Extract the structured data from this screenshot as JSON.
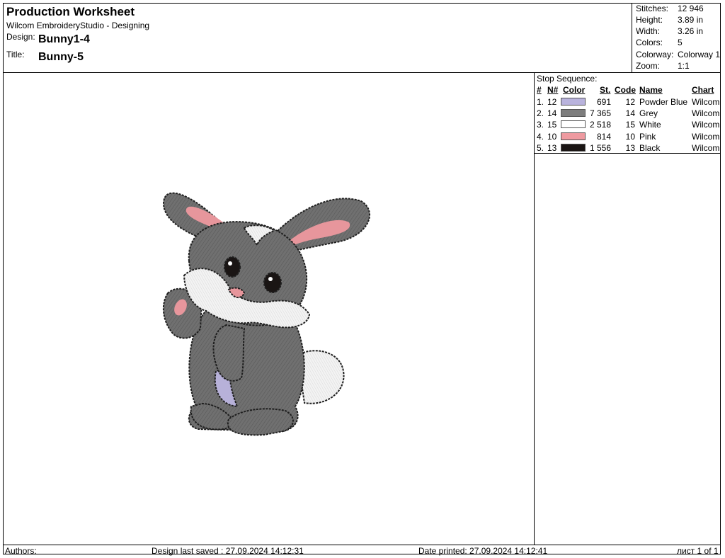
{
  "header": {
    "title": "Production Worksheet",
    "subtitle": "Wilcom EmbroideryStudio - Designing",
    "design_label": "Design:",
    "design_value": "Bunny1-4",
    "title_label": "Title:",
    "title_value": "Bunny-5"
  },
  "stats": [
    {
      "label": "Stitches:",
      "value": "12 946"
    },
    {
      "label": "Height:",
      "value": "3.89 in"
    },
    {
      "label": "Width:",
      "value": "3.26 in"
    },
    {
      "label": "Colors:",
      "value": "5"
    },
    {
      "label": "Colorway:",
      "value": "Colorway 1"
    },
    {
      "label": "Zoom:",
      "value": "1:1"
    }
  ],
  "stop_sequence": {
    "caption": "Stop Sequence:",
    "columns": {
      "idx": "#",
      "n": "N#",
      "color": "Color",
      "st": "St.",
      "code": "Code",
      "name": "Name",
      "chart": "Chart"
    },
    "rows": [
      {
        "idx": "1.",
        "n": "12",
        "swatch": "#b9b3dd",
        "st": "691",
        "code": "12",
        "name": "Powder Blue",
        "chart": "Wilcom"
      },
      {
        "idx": "2.",
        "n": "14",
        "swatch": "#7d7d7d",
        "st": "7 365",
        "code": "14",
        "name": "Grey",
        "chart": "Wilcom"
      },
      {
        "idx": "3.",
        "n": "15",
        "swatch": "#ffffff",
        "st": "2 518",
        "code": "15",
        "name": "White",
        "chart": "Wilcom"
      },
      {
        "idx": "4.",
        "n": "10",
        "swatch": "#ee9aa0",
        "st": "814",
        "code": "10",
        "name": "Pink",
        "chart": "Wilcom"
      },
      {
        "idx": "5.",
        "n": "13",
        "swatch": "#1a1514",
        "st": "1 556",
        "code": "13",
        "name": "Black",
        "chart": "Wilcom"
      }
    ]
  },
  "footer": {
    "authors": "Authors:",
    "saved": "Design last saved : 27.09.2024 14:12:31",
    "printed": "Date printed: 27.09.2024 14:12:41",
    "page": "лист 1 of 1"
  },
  "colors": {
    "grey": "#707070",
    "grey_dark": "#5f5f5f",
    "pink": "#e7969c",
    "lavender": "#b7b1d9",
    "white_fur": "#f2f2f2",
    "outline": "#1f1f1f"
  }
}
